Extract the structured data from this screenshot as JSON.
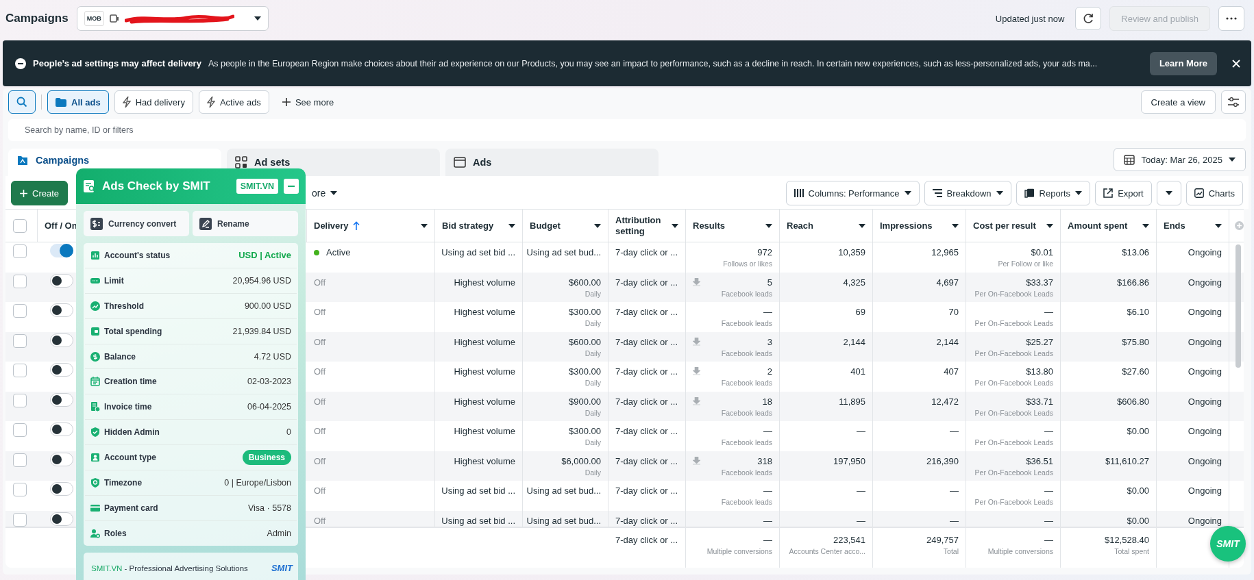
{
  "header": {
    "title": "Campaigns",
    "account_logo": "MOB",
    "updated": "Updated just now",
    "publish_button": {
      "label": "Review and publish",
      "disabled": true
    }
  },
  "banner": {
    "title": "People’s ad settings may affect delivery",
    "message": "As people in the European Region make choices about their ad experience on our Products, you may see an impact to performance, such as a decline in reach. In certain new experiences, such as less-personalized ads, your ads ma...",
    "button": "Learn More"
  },
  "filters": [
    {
      "label": "All ads",
      "selected": true
    },
    {
      "label": "Had delivery",
      "selected": false
    },
    {
      "label": "Active ads",
      "selected": false
    }
  ],
  "see_more": "See more",
  "create_view": "Create a view",
  "search": {
    "placeholder": "Search by name, ID or filters"
  },
  "tabs": [
    {
      "label": "Campaigns",
      "selected": true
    },
    {
      "label": "Ad sets",
      "selected": false
    },
    {
      "label": "Ads",
      "selected": false
    }
  ],
  "date_button": "Today: Mar 26, 2025",
  "toolbar": {
    "create": "Create",
    "more": "ore",
    "columns": "Columns: Performance",
    "breakdown": "Breakdown",
    "reports": "Reports",
    "export": "Export",
    "charts": "Charts"
  },
  "table": {
    "all_selected": false,
    "toggle_header": "Off / On",
    "columns": [
      {
        "label": "Delivery",
        "sorted": true
      },
      {
        "label": "Bid strategy",
        "sorted": false
      },
      {
        "label": "Budget",
        "sorted": false
      },
      {
        "label": "Attribution setting",
        "sorted": false
      },
      {
        "label": "Results",
        "sorted": false
      },
      {
        "label": "Reach",
        "sorted": false
      },
      {
        "label": "Impressions",
        "sorted": false
      },
      {
        "label": "Cost per result",
        "sorted": false
      },
      {
        "label": "Amount spent",
        "sorted": false
      },
      {
        "label": "Ends",
        "sorted": false
      }
    ],
    "rows": [
      {
        "selected": false,
        "on": true,
        "active": true,
        "delivery": "Active",
        "bid": "Using ad set bid ...",
        "budget": "Using ad set bud...",
        "attribution": "7-day click or ...",
        "lead_icon": false,
        "results": "972",
        "results_note": "Follows or likes",
        "reach": "10,359",
        "impressions": "12,965",
        "cost": "$0.01",
        "cost_note": "Per Follow or like",
        "spent": "$13.06",
        "ends": "Ongoing"
      },
      {
        "selected": false,
        "on": false,
        "active": false,
        "delivery": "Off",
        "bid": "Highest volume",
        "budget": "$600.00",
        "budget_note": "Daily",
        "attribution": "7-day click or ...",
        "lead_icon": true,
        "results": "5",
        "results_note": "Facebook leads",
        "reach": "4,325",
        "impressions": "4,697",
        "cost": "$33.37",
        "cost_note": "Per On-Facebook Leads",
        "spent": "$166.86",
        "ends": "Ongoing"
      },
      {
        "selected": false,
        "on": false,
        "active": false,
        "delivery": "Off",
        "bid": "Highest volume",
        "budget": "$300.00",
        "budget_note": "Daily",
        "attribution": "7-day click or ...",
        "lead_icon": false,
        "results": "—",
        "results_note": "Facebook leads",
        "reach": "69",
        "impressions": "70",
        "cost": "—",
        "cost_note": "Per On-Facebook Leads",
        "spent": "$6.10",
        "ends": "Ongoing"
      },
      {
        "selected": false,
        "on": false,
        "active": false,
        "delivery": "Off",
        "bid": "Highest volume",
        "budget": "$600.00",
        "budget_note": "Daily",
        "attribution": "7-day click or ...",
        "lead_icon": true,
        "results": "3",
        "results_note": "Facebook leads",
        "reach": "2,144",
        "impressions": "2,144",
        "cost": "$25.27",
        "cost_note": "Per On-Facebook Leads",
        "spent": "$75.80",
        "ends": "Ongoing"
      },
      {
        "selected": false,
        "on": false,
        "active": false,
        "delivery": "Off",
        "bid": "Highest volume",
        "budget": "$300.00",
        "budget_note": "Daily",
        "attribution": "7-day click or ...",
        "lead_icon": true,
        "results": "2",
        "results_note": "Facebook leads",
        "reach": "401",
        "impressions": "407",
        "cost": "$13.80",
        "cost_note": "Per On-Facebook Leads",
        "spent": "$27.60",
        "ends": "Ongoing"
      },
      {
        "selected": false,
        "on": false,
        "active": false,
        "delivery": "Off",
        "bid": "Highest volume",
        "budget": "$900.00",
        "budget_note": "Daily",
        "attribution": "7-day click or ...",
        "lead_icon": true,
        "results": "18",
        "results_note": "Facebook leads",
        "reach": "11,895",
        "impressions": "12,472",
        "cost": "$33.71",
        "cost_note": "Per On-Facebook Leads",
        "spent": "$606.80",
        "ends": "Ongoing"
      },
      {
        "selected": false,
        "on": false,
        "active": false,
        "delivery": "Off",
        "bid": "Highest volume",
        "budget": "$300.00",
        "budget_note": "Daily",
        "attribution": "7-day click or ...",
        "lead_icon": false,
        "results": "—",
        "results_note": "Facebook leads",
        "reach": "—",
        "impressions": "—",
        "cost": "—",
        "cost_note": "Per On-Facebook Leads",
        "spent": "$0.00",
        "ends": "Ongoing"
      },
      {
        "selected": false,
        "on": false,
        "active": false,
        "delivery": "Off",
        "bid": "Highest volume",
        "budget": "$6,000.00",
        "budget_note": "Daily",
        "attribution": "7-day click or ...",
        "lead_icon": true,
        "results": "318",
        "results_note": "Facebook leads",
        "reach": "197,950",
        "impressions": "216,390",
        "cost": "$36.51",
        "cost_note": "Per On-Facebook Leads",
        "spent": "$11,610.27",
        "ends": "Ongoing"
      },
      {
        "selected": false,
        "on": false,
        "active": false,
        "delivery": "Off",
        "bid": "Using ad set bid ...",
        "budget": "Using ad set bud...",
        "attribution": "7-day click or ...",
        "lead_icon": false,
        "results": "—",
        "results_note": "Facebook leads",
        "reach": "—",
        "impressions": "—",
        "cost": "—",
        "cost_note": "Per On-Facebook Leads",
        "spent": "$0.00",
        "ends": "Ongoing"
      },
      {
        "selected": false,
        "on": false,
        "active": false,
        "delivery": "Off",
        "bid": "Using ad set bid ...",
        "budget": "Using ad set bud...",
        "attribution": "7-day click or ...",
        "lead_icon": false,
        "results": "—",
        "reach": "—",
        "impressions": "—",
        "cost": "—",
        "spent": "$0.00",
        "ends": "Ongoing"
      }
    ],
    "totals": {
      "attribution": "7-day click or ...",
      "results": "—",
      "results_note": "Multiple conversions",
      "reach": "223,541",
      "reach_note": "Accounts Center acco...",
      "impressions": "249,757",
      "impressions_note": "Total",
      "cost": "—",
      "cost_note": "Multiple conversions",
      "spent": "$12,528.40",
      "spent_note": "Total spent"
    }
  },
  "smit_panel": {
    "title": "Ads Check by SMIT",
    "site_button": "SMIT.VN",
    "actions": [
      "Currency convert",
      "Rename"
    ],
    "info": [
      {
        "kind": "status",
        "label": "Account's status",
        "value": "USD | Active"
      },
      {
        "kind": "text",
        "label": "Limit",
        "value": "20,954.96 USD"
      },
      {
        "kind": "text",
        "label": "Threshold",
        "value": "900.00 USD"
      },
      {
        "kind": "text",
        "label": "Total spending",
        "value": "21,939.84 USD"
      },
      {
        "kind": "text",
        "label": "Balance",
        "value": "4.72 USD"
      },
      {
        "kind": "text",
        "label": "Creation time",
        "value": "02-03-2023"
      },
      {
        "kind": "text",
        "label": "Invoice time",
        "value": "06-04-2025"
      },
      {
        "kind": "text",
        "label": "Hidden Admin",
        "value": "0"
      },
      {
        "kind": "pill",
        "label": "Account type",
        "value": "Business"
      },
      {
        "kind": "text",
        "label": "Timezone",
        "value": "0 | Europe/Lisbon"
      },
      {
        "kind": "text",
        "label": "Payment card",
        "value": "Visa · 5578"
      },
      {
        "kind": "text",
        "label": "Roles",
        "value": "Admin"
      }
    ],
    "footer": {
      "brand": "SMIT.VN",
      "tagline": " - Professional Advertising Solutions",
      "logo": "SMIT"
    }
  },
  "smit_fab": "SMIT"
}
